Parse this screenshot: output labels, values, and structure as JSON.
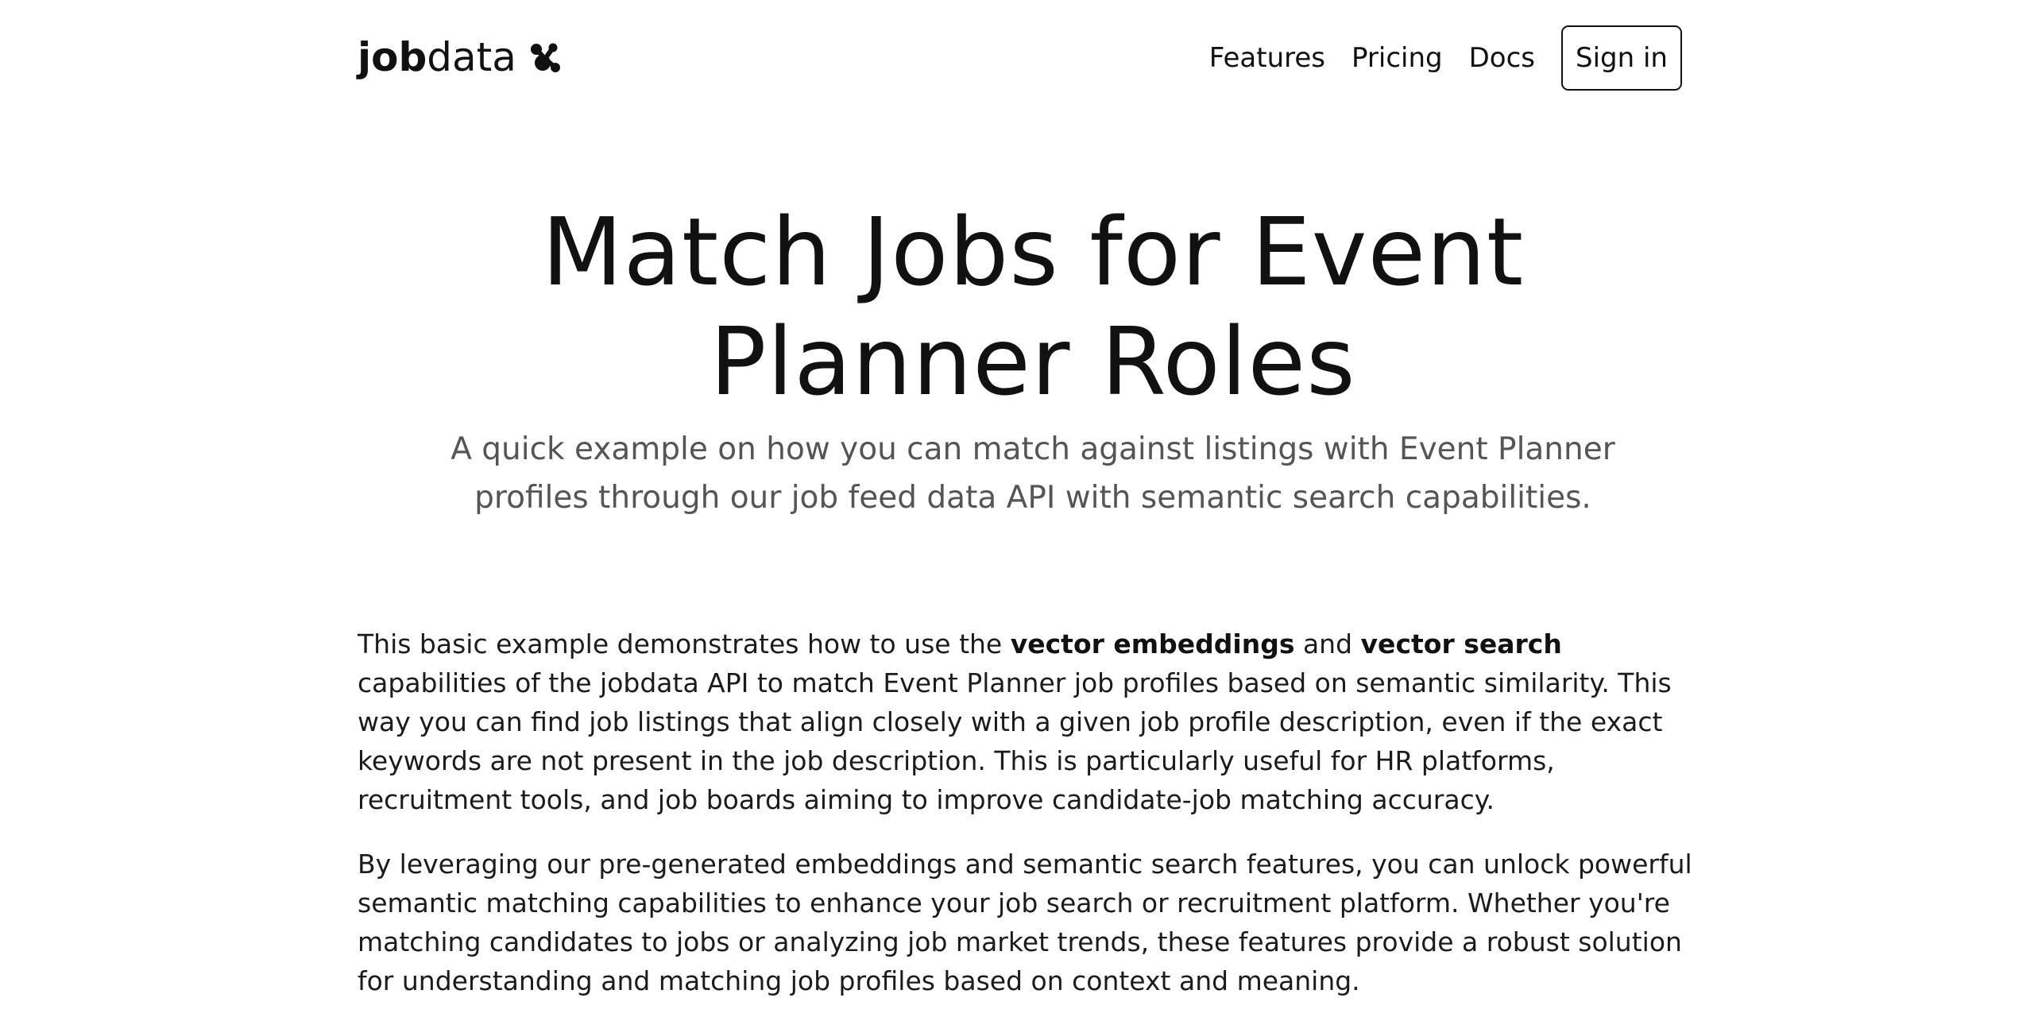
{
  "header": {
    "logo_bold": "job",
    "logo_light": "data",
    "nav": [
      "Features",
      "Pricing",
      "Docs"
    ],
    "signin_label": "Sign in"
  },
  "hero": {
    "title": "Match Jobs for Event Planner Roles",
    "subtitle": "A quick example on how you can match against listings with Event Planner profiles through our job feed data API with semantic search capabilities."
  },
  "content": {
    "p1": {
      "pre": "This basic example demonstrates how to use the ",
      "strong1": "vector embeddings",
      "mid": " and ",
      "strong2": "vector search",
      "post": " capabilities of the jobdata API to match Event Planner job profiles based on semantic similarity. This way you can find job listings that align closely with a given job profile description, even if the exact keywords are not present in the job description. This is particularly useful for HR platforms, recruitment tools, and job boards aiming to improve candidate-job matching accuracy."
    },
    "p2": "By leveraging our pre-generated embeddings and semantic search features, you can unlock powerful semantic matching capabilities to enhance your job search or recruitment platform. Whether you're matching candidates to jobs or analyzing job market trends, these features provide a robust solution for understanding and matching job profiles based on context and meaning."
  }
}
